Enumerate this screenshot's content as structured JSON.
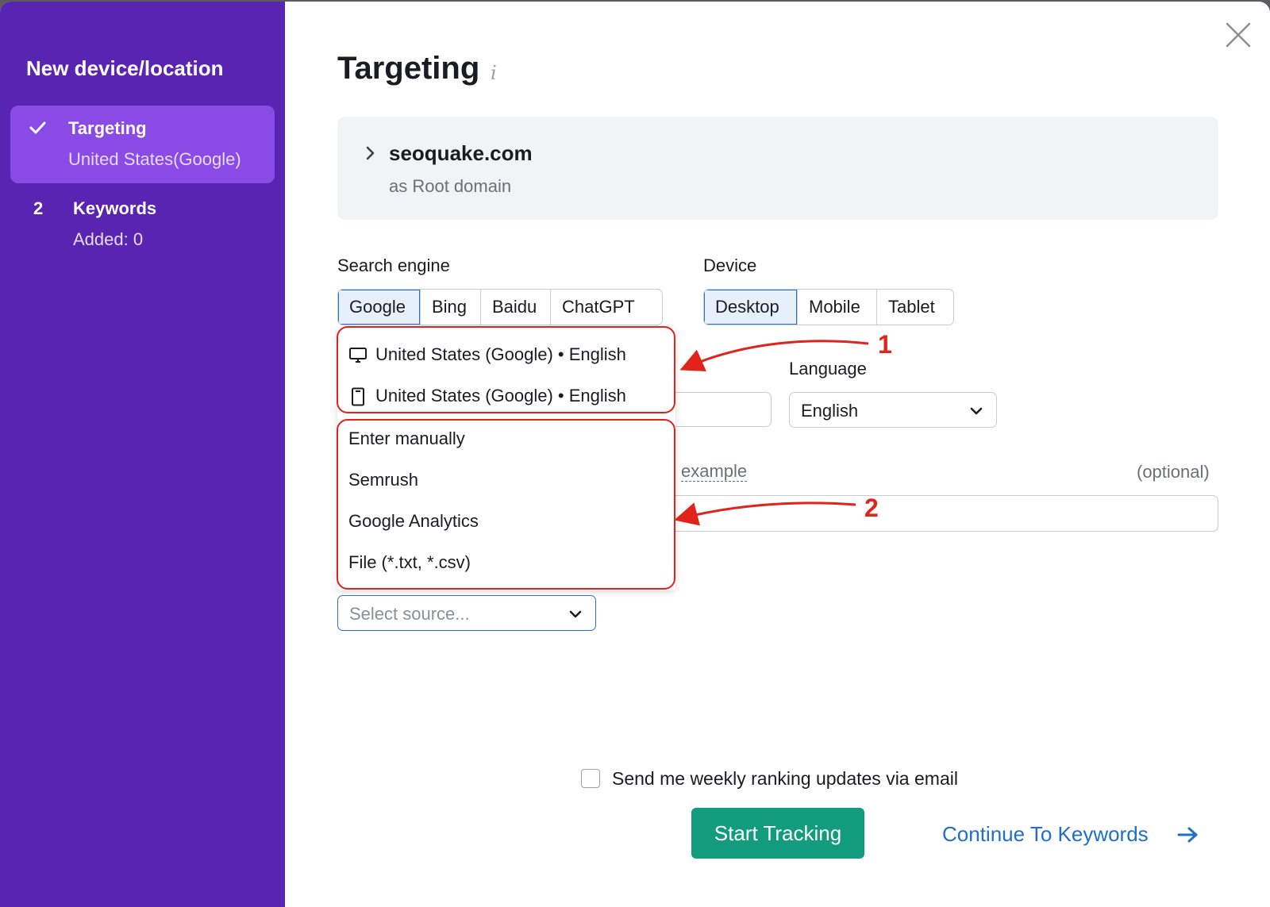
{
  "sidebar": {
    "title": "New device/location",
    "steps": [
      {
        "label": "Targeting",
        "sub": "United States(Google)",
        "state": "done"
      },
      {
        "number": "2",
        "label": "Keywords",
        "sub": "Added: 0"
      }
    ]
  },
  "main": {
    "title": "Targeting",
    "info_icon": "i",
    "domain": {
      "name": "seoquake.com",
      "type": "as Root domain"
    },
    "search_engine": {
      "label": "Search engine",
      "options": [
        "Google",
        "Bing",
        "Baidu",
        "ChatGPT"
      ],
      "selected": "Google"
    },
    "device": {
      "label": "Device",
      "options": [
        "Desktop",
        "Mobile",
        "Tablet"
      ],
      "selected": "Desktop"
    },
    "language": {
      "label": "Language",
      "value": "English"
    },
    "example_link": "example",
    "optional_label": "(optional)",
    "dropdown": {
      "recent_locations": [
        {
          "icon": "desktop-icon",
          "text": "United States (Google) • English"
        },
        {
          "icon": "mobile-icon",
          "text": "United States (Google) • English"
        }
      ],
      "sources": [
        "Enter manually",
        "Semrush",
        "Google Analytics",
        "File (*.txt, *.csv)"
      ]
    },
    "source_select": {
      "placeholder": "Select source..."
    },
    "email_checkbox": {
      "label": "Send me weekly ranking updates via email",
      "checked": false
    },
    "start_button": "Start Tracking",
    "continue_link": "Continue To Keywords"
  },
  "annotations": {
    "marker_1": "1",
    "marker_2": "2"
  },
  "colors": {
    "sidebar_bg": "#5a24b2",
    "sidebar_active": "#8a4ae6",
    "primary_green": "#129b7c",
    "link_blue": "#1f6fc9",
    "annotation_red": "#e0241b"
  }
}
